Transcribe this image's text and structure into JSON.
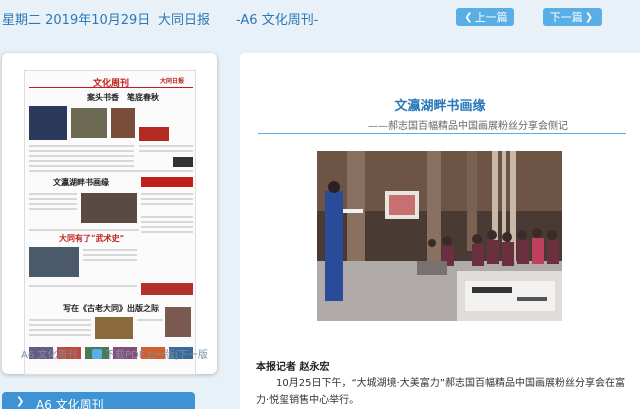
{
  "header": {
    "date": "星期二 2019年10月29日",
    "paper": "大同日报",
    "edition": "-A6 文化周刊-",
    "prev_label": "上一篇",
    "next_label": "下一篇"
  },
  "left_panel": {
    "thumbnail": {
      "masthead": "文化周刊",
      "brand": "大同日报",
      "headline1": "案头书香　笔底春秋",
      "headline2": "文瀛湖畔书画缘",
      "headline3": "大同有了“武术史”",
      "headline4": "写在《古老大同》出版之际"
    },
    "edition_label": "A6 文化周刊",
    "pdf_label": "下载PDF",
    "prev_page_label": "上一版",
    "sep": "|",
    "next_page_label": "下一版"
  },
  "edition_tab": {
    "label": "A6  文化周刊"
  },
  "article": {
    "title": "文瀛湖畔书画缘",
    "subtitle": "——郝志国百幅精品中国画展粉丝分享会侧记",
    "byline": "本报记者 赵永宏",
    "paragraph": "10月25日下午，“大城湖境·大美富力”郝志国百幅精品中国画展粉丝分享会在富力·悦玺销售中心举行。"
  },
  "colors": {
    "accent": "#2a77b9",
    "button": "#5aaee6",
    "tab": "#3d93d3",
    "background": "#e8f1f8"
  }
}
